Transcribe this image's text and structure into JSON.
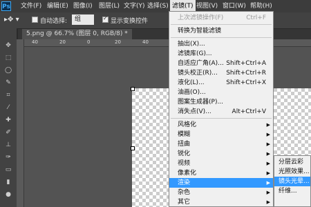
{
  "app": {
    "logo": "Ps"
  },
  "menubar": [
    "文件(F)",
    "编辑(E)",
    "图像(I)",
    "图层(L)",
    "文字(Y)",
    "选择(S)",
    "滤镜(T)",
    "视图(V)",
    "窗口(W)",
    "帮助(H)"
  ],
  "options": {
    "auto_select_label": "自动选择:",
    "auto_select_value": "组",
    "show_transform_label": "显示变换控件"
  },
  "document_tab": "5.png @ 66.7% (图层 0, RGB/8) *",
  "filter_menu": {
    "last_filter": {
      "label": "上次滤镜操作(F)",
      "shortcut": "Ctrl+F"
    },
    "convert_smart": "转换为智能滤镜",
    "group1": [
      {
        "label": "抽出(X)...",
        "shortcut": ""
      },
      {
        "label": "滤镜库(G)...",
        "shortcut": ""
      },
      {
        "label": "自适应广角(A)...",
        "shortcut": "Shift+Ctrl+A"
      },
      {
        "label": "镜头校正(R)...",
        "shortcut": "Shift+Ctrl+R"
      },
      {
        "label": "液化(L)...",
        "shortcut": "Shift+Ctrl+X"
      },
      {
        "label": "油画(O)...",
        "shortcut": ""
      },
      {
        "label": "图案生成器(P)...",
        "shortcut": ""
      },
      {
        "label": "消失点(V)...",
        "shortcut": "Alt+Ctrl+V"
      }
    ],
    "submenus": [
      "风格化",
      "模糊",
      "扭曲",
      "锐化",
      "视频",
      "像素化",
      "渲染",
      "杂色",
      "其它"
    ]
  },
  "render_submenu": [
    "分层云彩",
    "光照效果...",
    "镜头光晕...",
    "纤维..."
  ]
}
